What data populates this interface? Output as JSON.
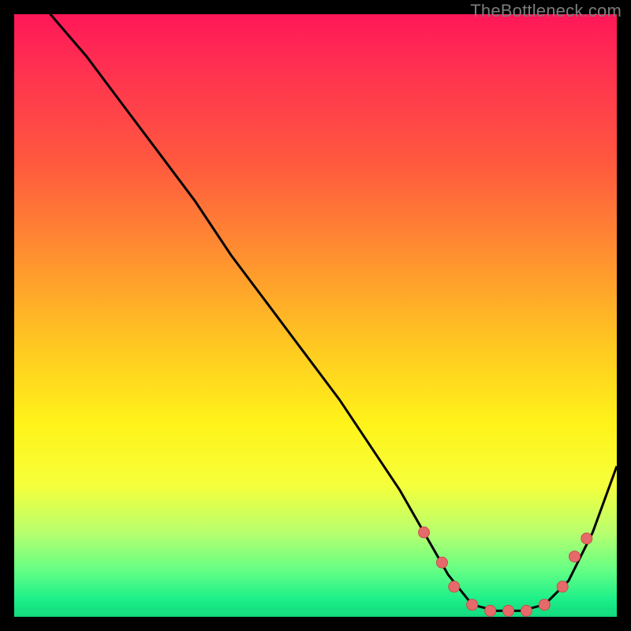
{
  "attribution": "TheBottleneck.com",
  "colors": {
    "page_bg": "#000000",
    "curve": "#000000",
    "marker_fill": "#e66a6a",
    "marker_stroke": "#c84e4e"
  },
  "chart_data": {
    "type": "line",
    "title": "",
    "xlabel": "",
    "ylabel": "",
    "xlim": [
      0,
      100
    ],
    "ylim": [
      0,
      100
    ],
    "grid": false,
    "legend": false,
    "series": [
      {
        "name": "curve",
        "x": [
          0,
          6,
          12,
          18,
          24,
          30,
          36,
          42,
          48,
          54,
          60,
          64,
          68,
          72,
          76,
          80,
          84,
          88,
          92,
          96,
          100
        ],
        "y": [
          110,
          100,
          93,
          85,
          77,
          69,
          60,
          52,
          44,
          36,
          27,
          21,
          14,
          7,
          2,
          1,
          1,
          2,
          6,
          14,
          25
        ]
      }
    ],
    "markers": [
      {
        "x": 68,
        "y": 14
      },
      {
        "x": 71,
        "y": 9
      },
      {
        "x": 73,
        "y": 5
      },
      {
        "x": 76,
        "y": 2
      },
      {
        "x": 79,
        "y": 1
      },
      {
        "x": 82,
        "y": 1
      },
      {
        "x": 85,
        "y": 1
      },
      {
        "x": 88,
        "y": 2
      },
      {
        "x": 91,
        "y": 5
      },
      {
        "x": 93,
        "y": 10
      },
      {
        "x": 95,
        "y": 13
      }
    ]
  }
}
